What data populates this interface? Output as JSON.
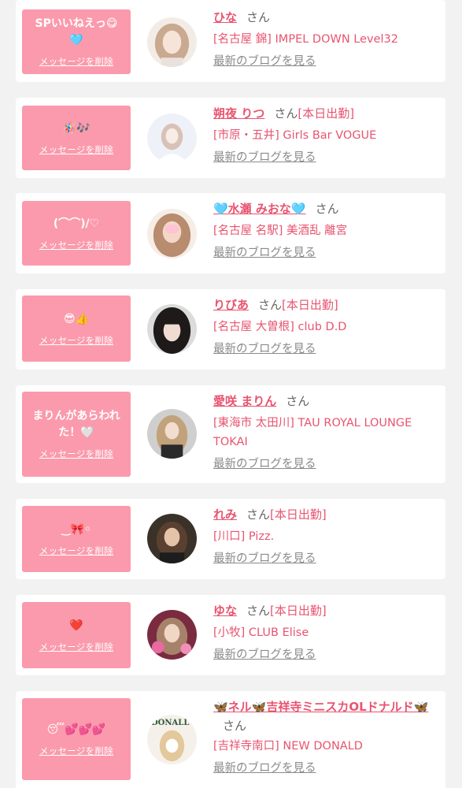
{
  "delete_label": "メッセージを削除",
  "blog_label": "最新のブログを見る",
  "honorific": "さん",
  "colors": {
    "accent": "#e8546f",
    "message_bg": "#fb9aac",
    "page_bg": "#f2f2f2"
  },
  "items": [
    {
      "message": "SPいいねえっ😋🩵",
      "name": "ひな",
      "status": "",
      "shop": "[名古屋 錦] IMPEL DOWN Level32",
      "avatar_icon": "photo-avatar"
    },
    {
      "message": "🪅🎶",
      "name": "朔夜 りつ",
      "status": "[本日出勤]",
      "shop": "[市原・五井] Girls Bar VOGUE",
      "avatar_icon": "photo-avatar"
    },
    {
      "message": "(⌒⌒)/♡",
      "name": "🩵水瀬 みおな🩵",
      "status": "",
      "shop": "[名古屋 名駅] 美酒乱 離宮",
      "avatar_icon": "photo-avatar"
    },
    {
      "message": "😎👍",
      "name": "りびあ",
      "status": "[本日出勤]",
      "shop": "[名古屋 大曽根] club D.D",
      "avatar_icon": "photo-avatar"
    },
    {
      "message": "まりんがあらわれた！🤍",
      "name": "愛咲 まりん",
      "status": "",
      "shop": "[東海市 太田川] TAU ROYAL LOUNGE TOKAI",
      "avatar_icon": "photo-avatar"
    },
    {
      "message": "‿🎀◦",
      "name": "れみ",
      "status": "[本日出勤]",
      "shop": "[川口] Pizz.",
      "avatar_icon": "photo-avatar"
    },
    {
      "message": "❤️",
      "name": "ゆな",
      "status": "[本日出勤]",
      "shop": "[小牧] CLUB Elise",
      "avatar_icon": "photo-avatar"
    },
    {
      "message": "😴💕💕💕",
      "name": "🦋ネル🦋吉祥寺ミニスカOLドナルド🦋",
      "status": "",
      "shop": "[吉祥寺南口] NEW DONALD",
      "avatar_icon": "photo-avatar",
      "avatar_sign": "DONALL"
    }
  ]
}
